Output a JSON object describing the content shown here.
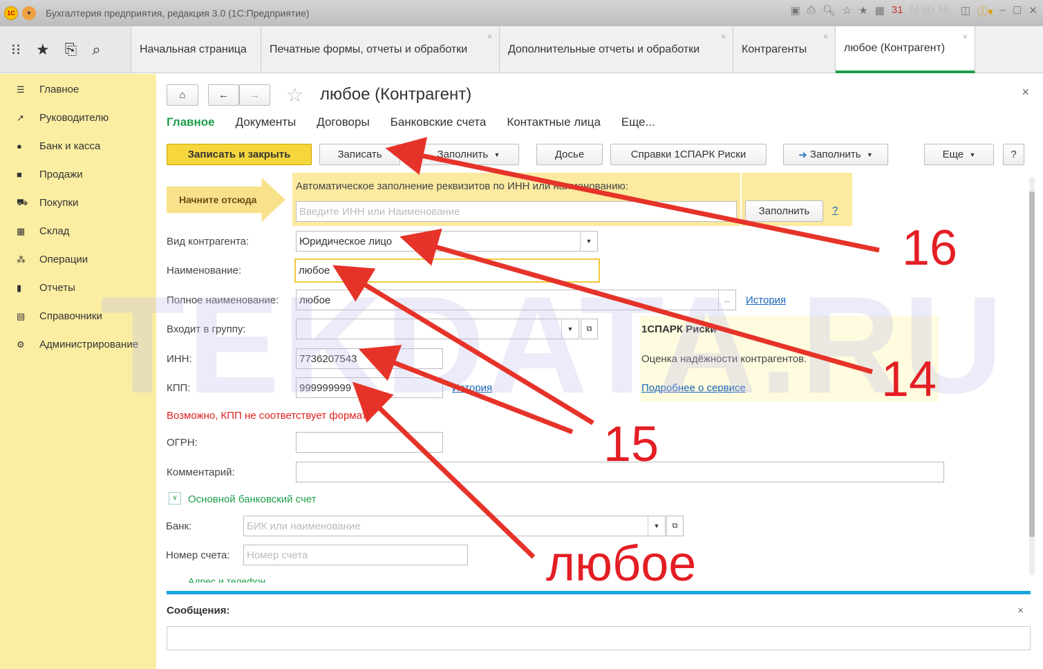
{
  "window": {
    "title": "Бухгалтерия предприятия, редакция 3.0  (1С:Предприятие)"
  },
  "tabs": [
    "Начальная страница",
    "Печатные формы, отчеты и обработки",
    "Дополнительные отчеты и обработки",
    "Контрагенты",
    "любое (Контрагент)"
  ],
  "sidebar": [
    "Главное",
    "Руководителю",
    "Банк и касса",
    "Продажи",
    "Покупки",
    "Склад",
    "Операции",
    "Отчеты",
    "Справочники",
    "Администрирование"
  ],
  "form": {
    "title": "любое (Контрагент)",
    "subtabs": [
      "Главное",
      "Документы",
      "Договоры",
      "Банковские счета",
      "Контактные лица",
      "Еще..."
    ],
    "buttons": {
      "save_close": "Записать и закрыть",
      "save": "Записать",
      "fill": "Заполнить",
      "dossier": "Досье",
      "spark": "Справки 1СПАРК Риски",
      "fill2": "Заполнить",
      "more": "Еще",
      "help": "?"
    },
    "start_here": "Начните отсюда",
    "auto_fill_label": "Автоматическое заполнение реквизитов по ИНН или наименованию:",
    "auto_fill_placeholder": "Введите ИНН или Наименование",
    "auto_fill_button": "Заполнить",
    "auto_help": "?",
    "fields": {
      "kind_label": "Вид контрагента:",
      "kind": "Юридическое лицо",
      "name_label": "Наименование:",
      "name": "любое",
      "full_label": "Полное наименование:",
      "full": "любое",
      "history": "История",
      "group_label": "Входит в группу:",
      "inn_label": "ИНН:",
      "inn": "7736207543",
      "kpp_label": "КПП:",
      "kpp": "999999999",
      "kpp_history": "История",
      "kpp_warning": "Возможно, КПП не соответствует формату",
      "ogrn_label": "ОГРН:",
      "comment_label": "Комментарий:",
      "bank_section": "Основной банковский счет",
      "bank_label": "Банк:",
      "bank_placeholder": "БИК или наименование",
      "account_label": "Номер счета:",
      "account_placeholder": "Номер счета",
      "address_section": "Адрес и телефон"
    },
    "spark": {
      "title": "1СПАРК Риски",
      "text": "Оценка надёжности контрагентов.",
      "link": "Подробнее о сервисе"
    },
    "messages": "Сообщения:"
  },
  "annotations": [
    "16",
    "14",
    "15",
    "любое"
  ],
  "watermark": "TEKDATA.RU"
}
